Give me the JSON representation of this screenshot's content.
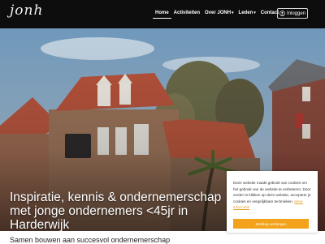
{
  "header": {
    "logo_text": "jonh",
    "nav": [
      {
        "label": "Home",
        "active": true
      },
      {
        "label": "Activiteiten",
        "active": false
      },
      {
        "label": "Over JONH",
        "active": false,
        "dropdown": true
      },
      {
        "label": "Leden",
        "active": false,
        "dropdown": true
      },
      {
        "label": "Contact",
        "active": false
      }
    ],
    "login_label": "Inloggen",
    "login_icon": "user-circle-icon"
  },
  "hero": {
    "title": "Inspiratie, kennis & ondernemerschap met jonge ondernemers <45jr in Harderwijk"
  },
  "cookie_notice": {
    "text": "Deze website maakt gebruik van cookies om het gebruik van de website te verbeteren. Door verder te klikken op deze website, accepteer je cookies en vergelijkbare technieken.",
    "link_label": "Meer informatie",
    "button_label": "Melding verbergen",
    "accent_color": "#f2a21b"
  },
  "section": {
    "heading": "Samen bouwen aan succesvol ondernemerschap"
  }
}
